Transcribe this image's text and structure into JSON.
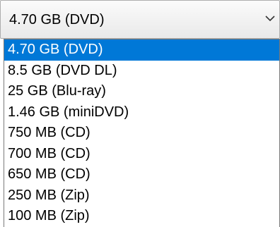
{
  "select": {
    "value": "4.70 GB (DVD)",
    "chevron_icon": "chevron-down-icon"
  },
  "options": [
    {
      "label": "4.70 GB (DVD)",
      "selected": true
    },
    {
      "label": "8.5 GB (DVD DL)",
      "selected": false
    },
    {
      "label": "25 GB (Blu-ray)",
      "selected": false
    },
    {
      "label": "1.46 GB (miniDVD)",
      "selected": false
    },
    {
      "label": "750 MB (CD)",
      "selected": false
    },
    {
      "label": "700 MB (CD)",
      "selected": false
    },
    {
      "label": "650 MB (CD)",
      "selected": false
    },
    {
      "label": "250 MB (Zip)",
      "selected": false
    },
    {
      "label": "100 MB (Zip)",
      "selected": false
    }
  ],
  "colors": {
    "highlight": "#0078d7",
    "highlight_text": "#ffffff"
  }
}
